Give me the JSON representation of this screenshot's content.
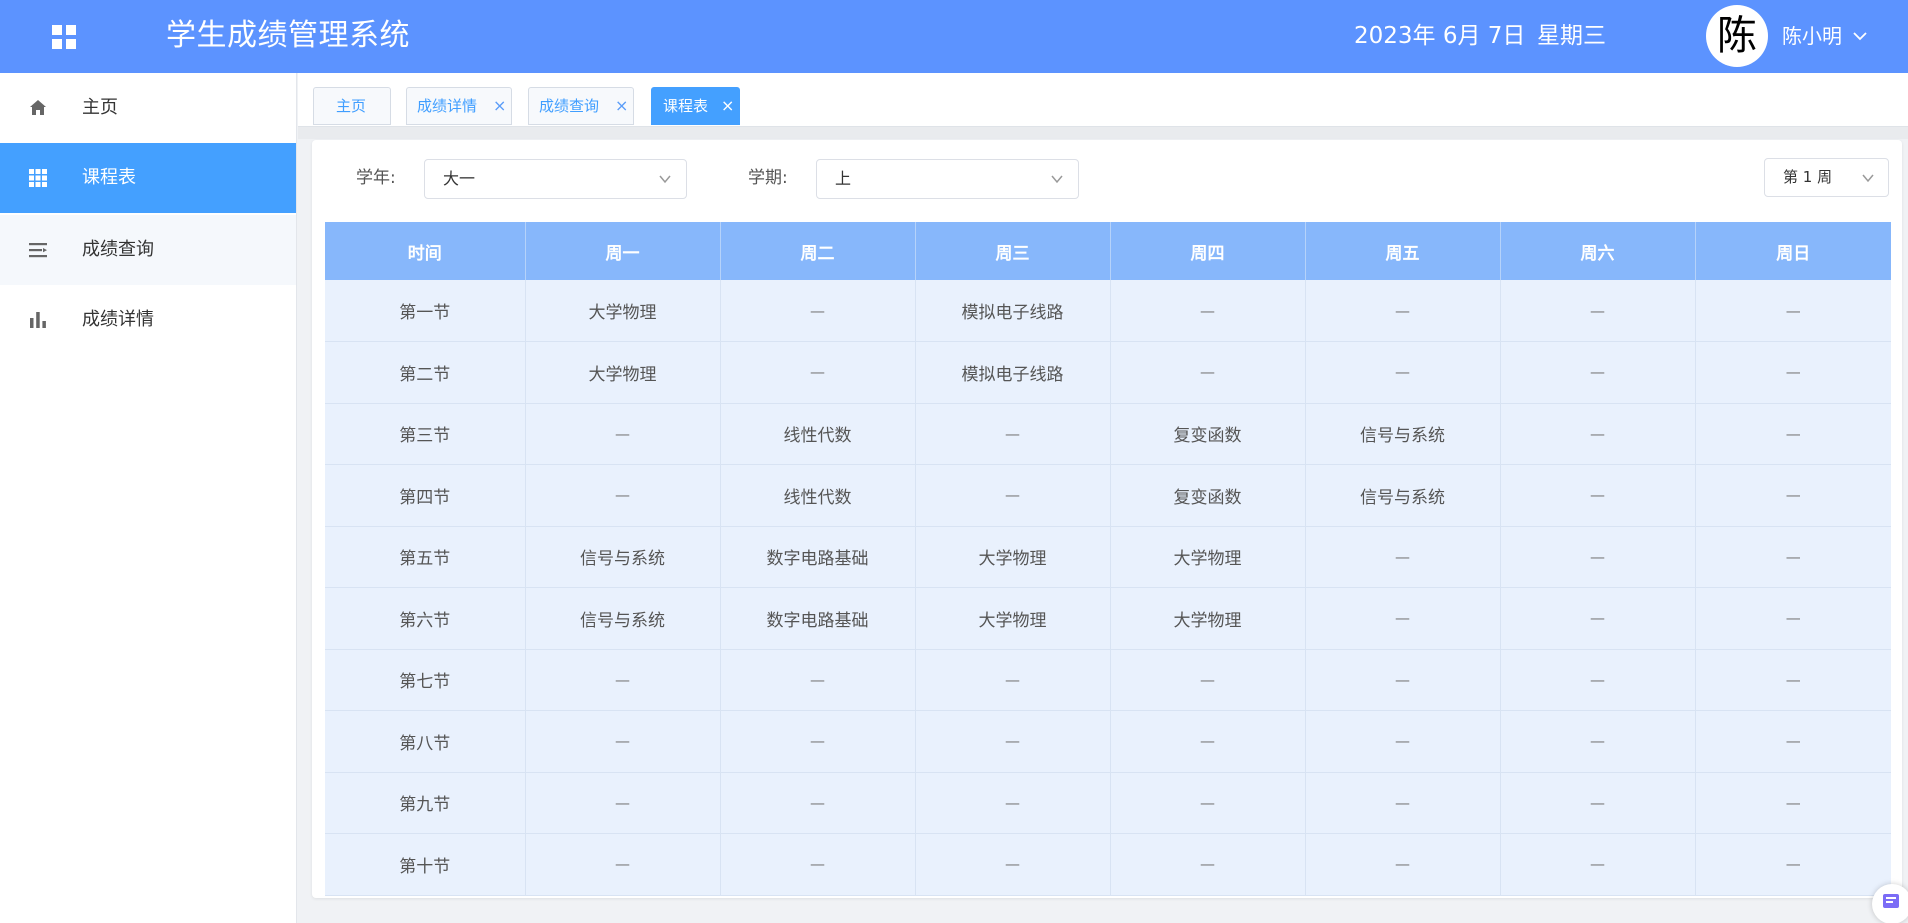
{
  "header": {
    "title": "学生成绩管理系统",
    "date": "2023年 6月 7日",
    "weekday": "星期三",
    "avatar_char": "陈",
    "user_name": "陈小明",
    "bg_color": "#5c93ff"
  },
  "sidebar": {
    "items": [
      {
        "label": "主页",
        "icon": "home-icon"
      },
      {
        "label": "课程表",
        "icon": "grid-icon",
        "active": true
      },
      {
        "label": "成绩查询",
        "icon": "list-icon"
      },
      {
        "label": "成绩详情",
        "icon": "bar-chart-icon"
      }
    ],
    "active_color": "#44a0ff"
  },
  "tabs": [
    {
      "label": "主页",
      "closable": false
    },
    {
      "label": "成绩详情",
      "closable": true
    },
    {
      "label": "成绩查询",
      "closable": true
    },
    {
      "label": "课程表",
      "closable": true,
      "active": true
    }
  ],
  "filters": {
    "year_label": "学年:",
    "year_value": "大一",
    "term_label": "学期:",
    "term_value": "上",
    "week_value": "第 1 周"
  },
  "timetable": {
    "headers": [
      "时间",
      "周一",
      "周二",
      "周三",
      "周四",
      "周五",
      "周六",
      "周日"
    ],
    "rows": [
      [
        "第一节",
        "大学物理",
        "—",
        "模拟电子线路",
        "—",
        "—",
        "—",
        "—"
      ],
      [
        "第二节",
        "大学物理",
        "—",
        "模拟电子线路",
        "—",
        "—",
        "—",
        "—"
      ],
      [
        "第三节",
        "—",
        "线性代数",
        "—",
        "复变函数",
        "信号与系统",
        "—",
        "—"
      ],
      [
        "第四节",
        "—",
        "线性代数",
        "—",
        "复变函数",
        "信号与系统",
        "—",
        "—"
      ],
      [
        "第五节",
        "信号与系统",
        "数字电路基础",
        "大学物理",
        "大学物理",
        "—",
        "—",
        "—"
      ],
      [
        "第六节",
        "信号与系统",
        "数字电路基础",
        "大学物理",
        "大学物理",
        "—",
        "—",
        "—"
      ],
      [
        "第七节",
        "—",
        "—",
        "—",
        "—",
        "—",
        "—",
        "—"
      ],
      [
        "第八节",
        "—",
        "—",
        "—",
        "—",
        "—",
        "—",
        "—"
      ],
      [
        "第九节",
        "—",
        "—",
        "—",
        "—",
        "—",
        "—",
        "—"
      ],
      [
        "第十节",
        "—",
        "—",
        "—",
        "—",
        "—",
        "—",
        "—"
      ]
    ],
    "header_color": "#87b7fb",
    "cell_color": "#e9f1fd"
  },
  "tab_close_glyph": "×"
}
